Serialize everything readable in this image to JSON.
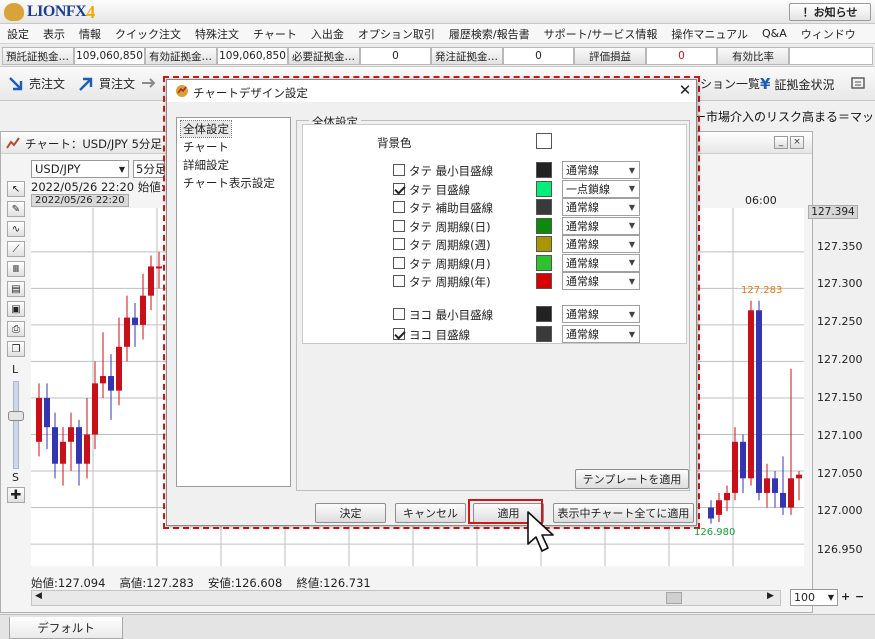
{
  "app": {
    "title_main": "LIONFX",
    "title_four": "4",
    "notice_button": "！お知らせ"
  },
  "menu": [
    "設定",
    "表示",
    "情報",
    "クイック注文",
    "特殊注文",
    "チャート",
    "入出金",
    "オプション取引",
    "履歴検索/報告書",
    "サポート/サービス情報",
    "操作マニュアル",
    "Q&A",
    "ウィンドウ"
  ],
  "infobar": {
    "deposit_label": "預託証拠金…",
    "deposit_value": "109,060,850",
    "effective_label": "有効証拠金…",
    "effective_value": "109,060,850",
    "required_label": "必要証拠金…",
    "required_value": "0",
    "order_label": "発注証拠金…",
    "order_value": "0",
    "pnl_label": "評価損益",
    "pnl_value": "0",
    "ratio_label": "有効比率"
  },
  "toolbar": {
    "sell_order": "売注文",
    "buy_order": "買注文",
    "position_list": "ション一覧",
    "margin_status": "証拠金状況"
  },
  "ticker": "ー市場介入のリスク高まる＝マッコ",
  "chart": {
    "title": "チャート：USD/JPY 5分足",
    "symbol": "USD/JPY",
    "interval": "5分足",
    "datetime_line": "2022/05/26 22:20  始値:",
    "datetime_tag": "2022/05/26 22:20",
    "time_label": "06:00",
    "current_price": "127.394",
    "high_label": "127.283",
    "low_label": "126.980",
    "sidebar_letter_l": "L",
    "sidebar_letter_s": "S",
    "ohlc": {
      "open": "始値:127.094",
      "high": "高値:127.283",
      "low": "安値:126.608",
      "close": "終値:126.731"
    },
    "zoom": "100"
  },
  "tabs": {
    "default": "デフォルト"
  },
  "dialog": {
    "title": "チャートデザイン設定",
    "nav": [
      "全体設定",
      "チャート",
      "詳細設定",
      "チャート表示設定"
    ],
    "group_title": "全体設定",
    "background_label": "背景色",
    "rows": [
      {
        "label": "タテ 最小目盛線",
        "checked": false,
        "color": "#222222",
        "line": "通常線"
      },
      {
        "label": "タテ 目盛線",
        "checked": true,
        "color": "#00ee77",
        "line": "一点鎖線"
      },
      {
        "label": "タテ 補助目盛線",
        "checked": false,
        "color": "#3a3a3a",
        "line": "通常線"
      },
      {
        "label": "タテ 周期線(日)",
        "checked": false,
        "color": "#0b8a0b",
        "line": "通常線"
      },
      {
        "label": "タテ 周期線(週)",
        "checked": false,
        "color": "#a89600",
        "line": "通常線"
      },
      {
        "label": "タテ 周期線(月)",
        "checked": false,
        "color": "#2fc12f",
        "line": "通常線"
      },
      {
        "label": "タテ 周期線(年)",
        "checked": false,
        "color": "#d60000",
        "line": "通常線"
      }
    ],
    "rows2": [
      {
        "label": "ヨコ 最小目盛線",
        "checked": false,
        "color": "#222222",
        "line": "通常線"
      },
      {
        "label": "ヨコ 目盛線",
        "checked": true,
        "color": "#3a3a3a",
        "line": "通常線"
      }
    ],
    "template_button": "テンプレートを適用",
    "ok_button": "決定",
    "cancel_button": "キャンセル",
    "apply_button": "適用",
    "apply_all_button": "表示中チャート全てに適用"
  },
  "chart_data": {
    "type": "candlestick",
    "y_ticks": [
      "127.350",
      "127.300",
      "127.250",
      "127.200",
      "127.150",
      "127.100",
      "127.050",
      "127.000",
      "126.950"
    ],
    "up_color": "#c8101a",
    "down_color": "#3535b0"
  }
}
